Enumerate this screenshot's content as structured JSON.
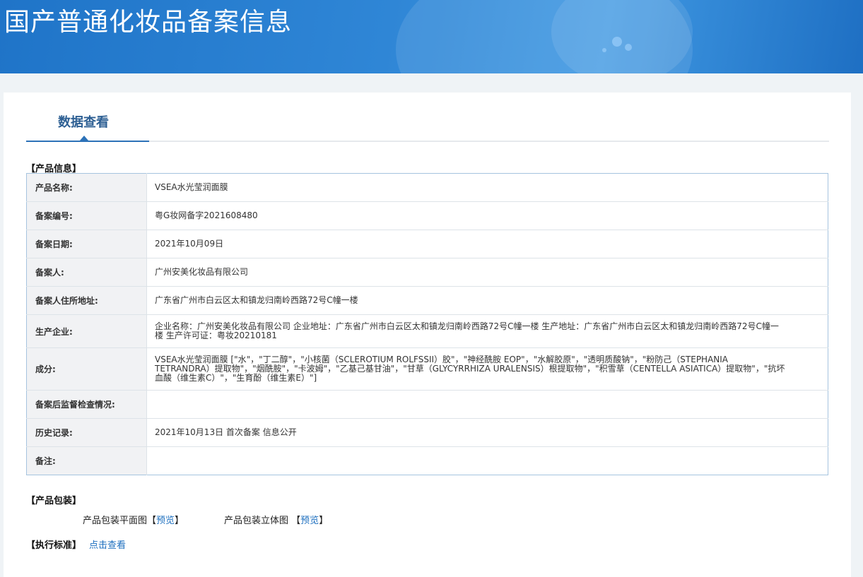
{
  "banner": {
    "title": "国产普通化妆品备案信息"
  },
  "tabs": [
    {
      "label": "数据查看",
      "active": true
    }
  ],
  "product_info": {
    "section_title": "【产品信息】",
    "rows": [
      {
        "label": "产品名称:",
        "value": "VSEA水光莹润面膜"
      },
      {
        "label": "备案编号:",
        "value": "粤G妆网备字2021608480"
      },
      {
        "label": "备案日期:",
        "value": "2021年10月09日"
      },
      {
        "label": "备案人:",
        "value": "广州安美化妆品有限公司"
      },
      {
        "label": "备案人住所地址:",
        "value": "广东省广州市白云区太和镇龙归南岭西路72号C幢一楼"
      },
      {
        "label": "生产企业:",
        "value": "企业名称：广州安美化妆品有限公司 企业地址：广东省广州市白云区太和镇龙归南岭西路72号C幢一楼 生产地址：广东省广州市白云区太和镇龙归南岭西路72号C幢一楼 生产许可证：粤妆20210181"
      },
      {
        "label": "成分:",
        "value": "VSEA水光莹润面膜 [\"水\"，\"丁二醇\"，\"小核菌（SCLEROTIUM ROLFSSII）胶\"，\"神经酰胺 EOP\"，\"水解胶原\"，\"透明质酸钠\"，\"粉防己（STEPHANIA TETRANDRA）提取物\"，\"烟酰胺\"，\"卡波姆\"，\"乙基己基甘油\"，\"甘草（GLYCYRRHIZA URALENSIS）根提取物\"，\"积雪草（CENTELLA ASIATICA）提取物\"，\"抗坏血酸（维生素C）\"，\"生育酚（维生素E）\"]"
      },
      {
        "label": "备案后监督检查情况:",
        "value": ""
      },
      {
        "label": "历史记录:",
        "value": "2021年10月13日 首次备案 信息公开"
      },
      {
        "label": "备注:",
        "value": ""
      }
    ]
  },
  "packaging": {
    "section_title": "【产品包装】",
    "flat_label": "产品包装平面图",
    "solid_label": "产品包装立体图",
    "bracket_open": "【",
    "bracket_close": "】",
    "preview_link": "预览"
  },
  "standard": {
    "section_title": "【执行标准】",
    "link": "点击查看"
  },
  "colors": {
    "banner": "#2a80d0",
    "tab_active": "#2c72b8",
    "link": "#1d6fbf",
    "table_border": "#a6c4df",
    "label_bg": "#f1f2f4"
  }
}
